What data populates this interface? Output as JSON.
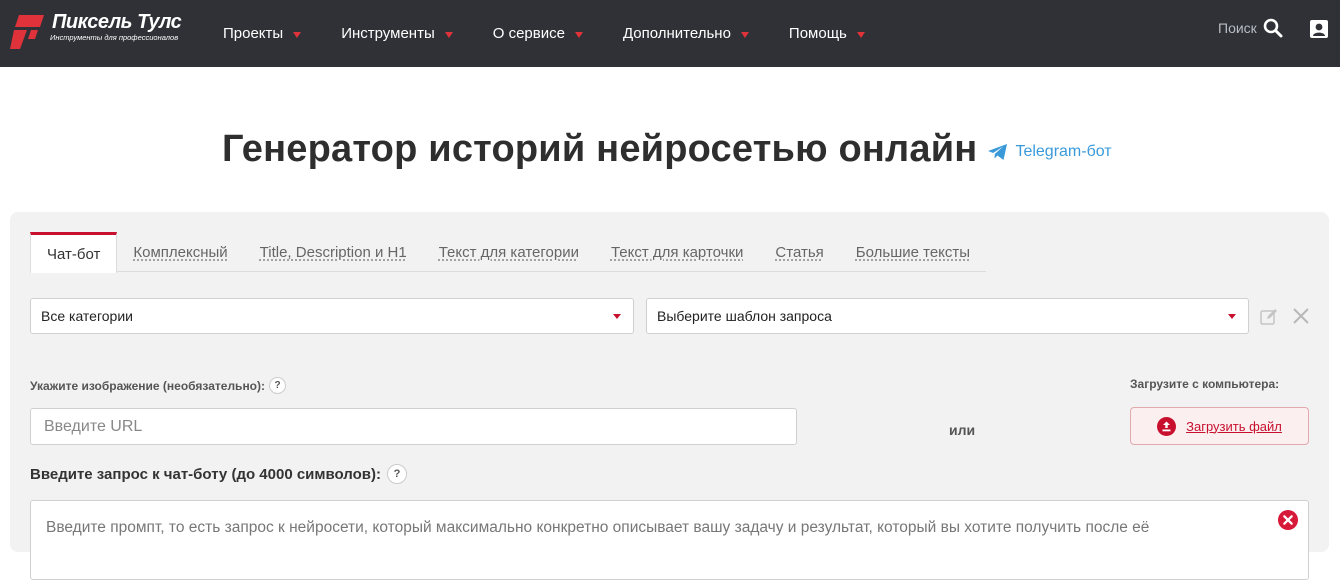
{
  "brand": {
    "name": "Пиксель Тулс",
    "tagline": "Инструменты для профессионалов",
    "accent": "#c8102e"
  },
  "nav": {
    "items": [
      {
        "label": "Проекты"
      },
      {
        "label": "Инструменты"
      },
      {
        "label": "О сервисе"
      },
      {
        "label": "Дополнительно"
      },
      {
        "label": "Помощь"
      }
    ],
    "search_label": "Поиск"
  },
  "page": {
    "title": "Генератор историй нейросетью онлайн",
    "telegram_label": "Telegram-бот"
  },
  "tabs": [
    {
      "label": "Чат-бот",
      "active": true
    },
    {
      "label": "Комплексный"
    },
    {
      "label": "Title, Description и H1"
    },
    {
      "label": "Текст для категории"
    },
    {
      "label": "Текст для карточки"
    },
    {
      "label": "Статья"
    },
    {
      "label": "Большие тексты"
    }
  ],
  "filters": {
    "category_value": "Все категории",
    "template_value": "Выберите шаблон запроса"
  },
  "image": {
    "label": "Укажите изображение (необязательно):",
    "url_placeholder": "Введите URL",
    "or_text": "или",
    "upload_label": "Загрузите с компьютера:",
    "upload_button": "Загрузить файл"
  },
  "query": {
    "label": "Введите запрос к чат-боту (до 4000 символов):",
    "placeholder": "Введите промпт, то есть запрос к нейросети, который максимально конкретно описывает вашу задачу и результат, который вы хотите получить после её"
  },
  "help_glyph": "?"
}
